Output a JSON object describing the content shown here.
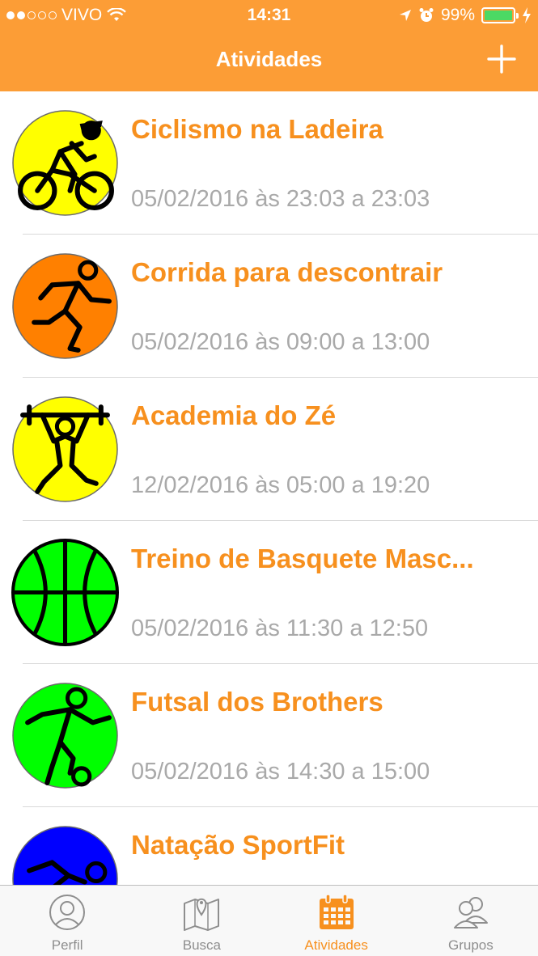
{
  "status_bar": {
    "carrier": "VIVO",
    "time": "14:31",
    "battery": "99%",
    "battery_level": 0.99
  },
  "nav": {
    "title": "Atividades",
    "add_icon": "plus-icon"
  },
  "activities": [
    {
      "title": "Ciclismo na Ladeira",
      "date": "05/02/2016 às 23:03 a 23:03",
      "icon": "cycling-icon",
      "color": "#FFFF00"
    },
    {
      "title": "Corrida para descontrair",
      "date": "05/02/2016 às 09:00 a 13:00",
      "icon": "running-icon",
      "color": "#FF8000"
    },
    {
      "title": "Academia do Zé",
      "date": "12/02/2016 às 05:00 a 19:20",
      "icon": "weightlifting-icon",
      "color": "#FFFF00"
    },
    {
      "title": "Treino de Basquete Masc...",
      "date": "05/02/2016 às 11:30 a 12:50",
      "icon": "basketball-icon",
      "color": "#00FF00"
    },
    {
      "title": "Futsal dos Brothers",
      "date": "05/02/2016 às 14:30 a 15:00",
      "icon": "soccer-icon",
      "color": "#00FF00"
    },
    {
      "title": "Natação SportFit",
      "date": "",
      "icon": "swimming-icon",
      "color": "#0000FF"
    }
  ],
  "tabbar": {
    "tabs": [
      {
        "label": "Perfil",
        "icon": "profile-icon",
        "active": false
      },
      {
        "label": "Busca",
        "icon": "map-icon",
        "active": false
      },
      {
        "label": "Atividades",
        "icon": "calendar-icon",
        "active": true
      },
      {
        "label": "Grupos",
        "icon": "group-icon",
        "active": false
      }
    ]
  },
  "colors": {
    "accent": "#FC9D36",
    "title_text": "#F7901E",
    "date_text": "#A9A9A9"
  }
}
